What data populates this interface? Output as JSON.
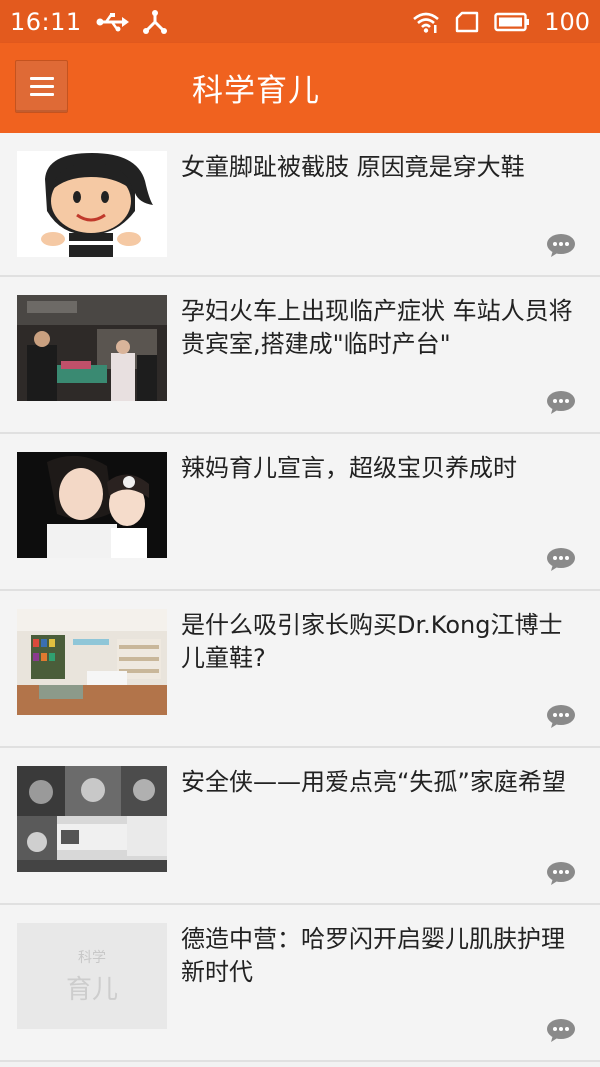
{
  "status_bar": {
    "time": "16:11",
    "battery_level": "100",
    "icons": [
      "usb-icon",
      "debug-icon",
      "wifi-icon",
      "sim-icon",
      "battery-icon"
    ]
  },
  "app_bar": {
    "title": "科学育儿",
    "menu_icon": "hamburger-menu-icon"
  },
  "articles": [
    {
      "title": "女童脚趾被截肢 原因竟是穿大鞋"
    },
    {
      "title": "孕妇火车上出现临产症状 车站人员将贵宾室,搭建成\"临时产台\""
    },
    {
      "title": "辣妈育儿宣言，超级宝贝养成时"
    },
    {
      "title": "是什么吸引家长购买Dr.Kong江博士儿童鞋?"
    },
    {
      "title": "安全侠——用爱点亮“失孤”家庭希望"
    },
    {
      "title": "德造中营：哈罗闪开启婴儿肌肤护理新时代",
      "placeholder_image_text": [
        "科学",
        "育儿"
      ]
    }
  ],
  "colors": {
    "status_bar": "#e35a1e",
    "app_bar": "#f0621f",
    "background": "#f4f4f4",
    "comment_icon": "#8a8a8a"
  }
}
